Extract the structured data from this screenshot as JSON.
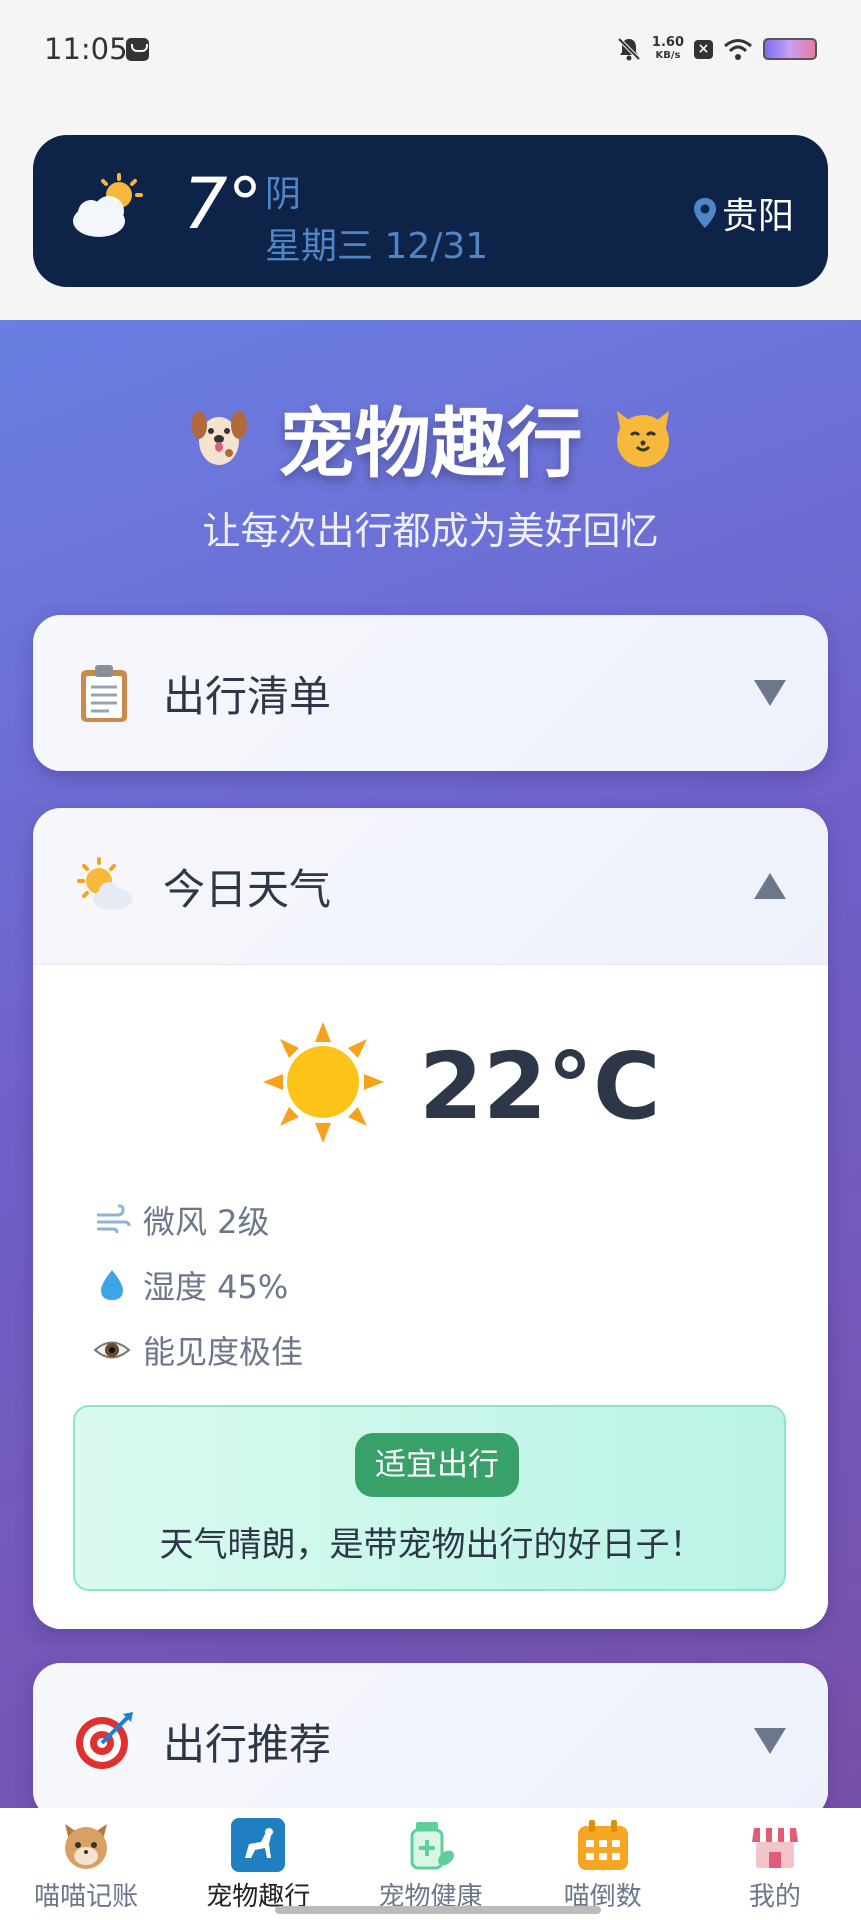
{
  "status_bar": {
    "time": "11:05",
    "net_speed_value": "1.60",
    "net_speed_unit": "KB/s",
    "icons": [
      "message-icon",
      "bell-muted-icon",
      "close-box-icon",
      "wifi-icon",
      "battery-icon"
    ]
  },
  "weather_widget": {
    "icon": "partly-cloudy-icon",
    "temperature": "7°",
    "condition": "阴",
    "date": "星期三 12/31",
    "city": "贵阳"
  },
  "hero": {
    "title": "宠物趣行",
    "subtitle": "让每次出行都成为美好回忆",
    "left_emoji": "dog-emoji",
    "right_emoji": "cat-emoji"
  },
  "sections": {
    "checklist": {
      "label": "出行清单",
      "icon": "clipboard-icon",
      "expanded": false
    },
    "weather": {
      "label": "今日天气",
      "icon": "sun-cloud-icon",
      "expanded": true,
      "temperature": "22°C",
      "details": [
        {
          "icon": "wind-icon",
          "text": "微风 2级"
        },
        {
          "icon": "droplet-icon",
          "text": "湿度 45%"
        },
        {
          "icon": "eye-icon",
          "text": "能见度极佳"
        }
      ],
      "advice_badge": "适宜出行",
      "advice_text": "天气晴朗，是带宠物出行的好日子！"
    },
    "recommend": {
      "label": "出行推荐",
      "icon": "target-icon",
      "expanded": false
    }
  },
  "nav": [
    {
      "label": "喵喵记账",
      "icon": "cat-face-icon",
      "active": false
    },
    {
      "label": "宠物趣行",
      "icon": "dog-walk-icon",
      "active": true
    },
    {
      "label": "宠物健康",
      "icon": "medicine-icon",
      "active": false
    },
    {
      "label": "喵倒数",
      "icon": "calendar-icon",
      "active": false
    },
    {
      "label": "我的",
      "icon": "shop-icon",
      "active": false
    }
  ],
  "colors": {
    "weather_card_bg": "#0d2347",
    "gradient_start": "#6a7fe3",
    "gradient_end": "#7750aa",
    "advice_badge": "#38a169",
    "nav_active_icon_bg": "#1f7fc0"
  }
}
